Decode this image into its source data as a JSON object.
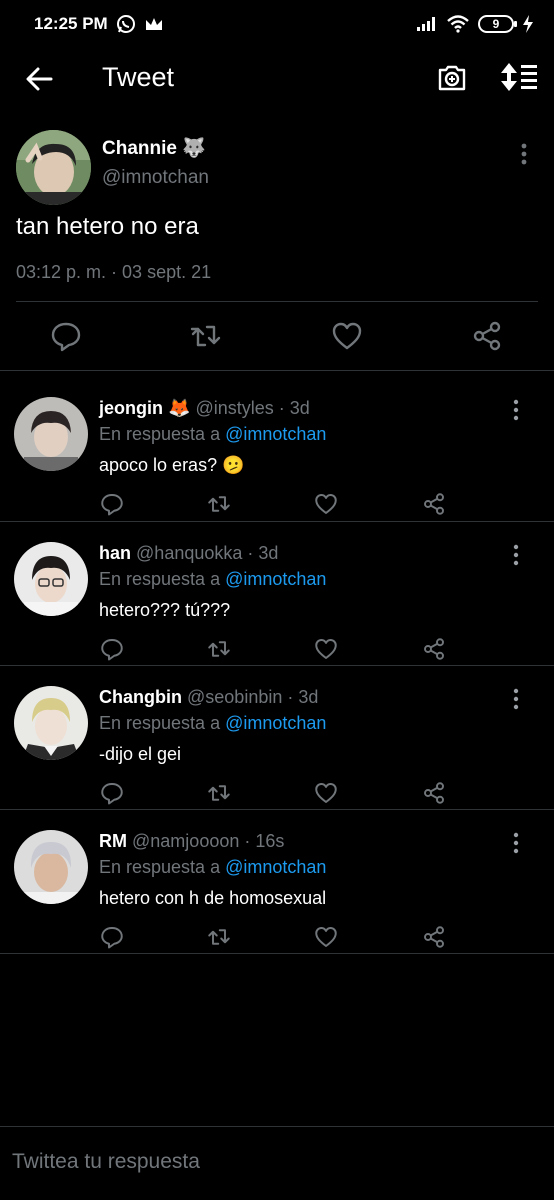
{
  "status_bar": {
    "time": "12:25 PM",
    "battery": "9",
    "icons": [
      "whatsapp-icon",
      "crown-icon",
      "signal-icon",
      "wifi-icon",
      "battery-icon",
      "charging-icon"
    ]
  },
  "header": {
    "title": "Tweet",
    "back_icon": "arrow-left-icon",
    "camera_icon": "camera-add-icon",
    "sort_icon": "sort-icon"
  },
  "main_tweet": {
    "name": "Channie",
    "emoji": "🐺",
    "handle": "@imnotchan",
    "text": "tan hetero no era",
    "timestamp": "03:12 p. m. · 03 sept. 21",
    "actions": [
      "reply-icon",
      "retweet-icon",
      "like-icon",
      "share-icon"
    ]
  },
  "replies": [
    {
      "name": "jeongin",
      "emoji": "🦊",
      "handle": "@instyles · 3d",
      "reply_prefix": "En respuesta a",
      "mention": "@imnotchan",
      "text": "apoco lo eras? 🫤"
    },
    {
      "name": "han",
      "emoji": "",
      "handle": "@hanquokka · 3d",
      "reply_prefix": "En respuesta a",
      "mention": "@imnotchan",
      "text": "hetero??? tú???"
    },
    {
      "name": "Changbin",
      "emoji": "",
      "handle": "@seobinbin · 3d",
      "reply_prefix": "En respuesta a",
      "mention": "@imnotchan",
      "text": "-dijo el gei"
    },
    {
      "name": "RM",
      "emoji": "",
      "handle": "@namjoooon · 16s",
      "reply_prefix": "En respuesta a",
      "mention": "@imnotchan",
      "text": "hetero con h de homosexual"
    }
  ],
  "compose": {
    "placeholder": "Twittea tu respuesta"
  },
  "colors": {
    "background": "#000000",
    "text": "#e7e9ea",
    "secondary": "#71767b",
    "accent": "#1d9bf0",
    "divider": "#2f3336"
  }
}
